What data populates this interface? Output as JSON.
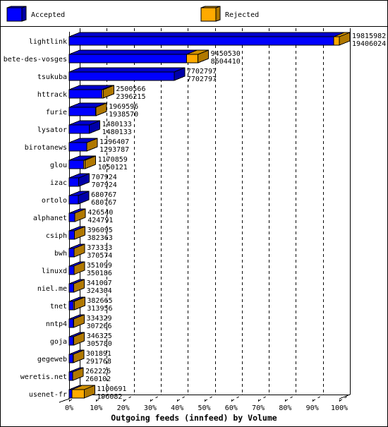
{
  "chart_data": {
    "type": "bar",
    "orientation": "horizontal",
    "stacked": true,
    "three_d": true,
    "title": "",
    "xlabel": "Outgoing feeds (innfeed) by Volume",
    "ylabel": "",
    "xlim": [
      0,
      100
    ],
    "x_unit": "% of largest feed total",
    "x_ticks": [
      "0%",
      "10%",
      "20%",
      "30%",
      "40%",
      "50%",
      "60%",
      "70%",
      "80%",
      "90%",
      "100%"
    ],
    "grid": true,
    "legend_position": "top",
    "legend": [
      {
        "label": "Accepted",
        "color": "#0000ff"
      },
      {
        "label": "Rejected",
        "color": "#ffaa00"
      }
    ],
    "categories": [
      "lightlink",
      "bete-des-vosges",
      "tsukuba",
      "httrack",
      "furie",
      "lysator",
      "birotanews",
      "glou",
      "izac",
      "ortolo",
      "alphanet",
      "csiph",
      "bwh",
      "linuxd",
      "niel.me",
      "tnet",
      "nntp4",
      "goja",
      "gegeweb",
      "weretis.net",
      "usenet-fr"
    ],
    "totals": [
      19815982,
      9450530,
      7702797,
      2500566,
      1969596,
      1480133,
      1296407,
      1170859,
      707924,
      680767,
      426540,
      396095,
      373333,
      351099,
      341007,
      382665,
      334329,
      346325,
      301891,
      262226,
      1100691
    ],
    "series": [
      {
        "name": "Accepted",
        "values": [
          19406024,
          8604410,
          7702797,
          2396215,
          1938570,
          1480133,
          1293787,
          1050121,
          707924,
          680767,
          424791,
          382363,
          370574,
          350186,
          324304,
          313956,
          307266,
          305780,
          291768,
          260102,
          196082
        ]
      },
      {
        "name": "Rejected",
        "values": [
          409958,
          846120,
          0,
          104351,
          31026,
          0,
          2620,
          120738,
          0,
          0,
          1749,
          13732,
          2759,
          913,
          16703,
          68709,
          27063,
          40545,
          10123,
          2124,
          904609
        ]
      }
    ]
  }
}
